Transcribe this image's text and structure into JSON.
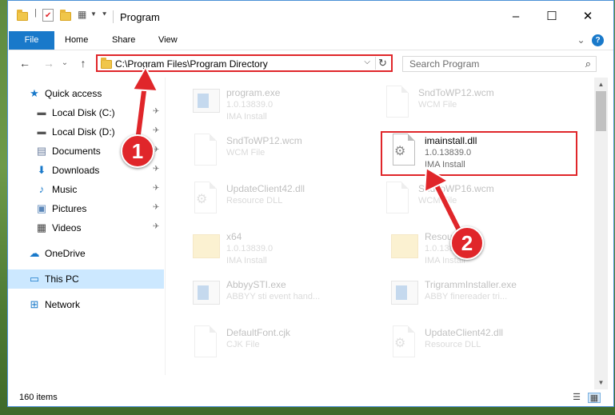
{
  "window": {
    "title": "Program",
    "minimize": "–",
    "maximize": "☐",
    "close": "✕"
  },
  "ribbon": {
    "tabs": [
      "File",
      "Home",
      "Share",
      "View"
    ],
    "expand": "⌄",
    "help": "?"
  },
  "address": {
    "path": "C:\\Program Files\\Program Directory",
    "dropdown": "⌵",
    "refresh": "↻"
  },
  "search": {
    "placeholder": "Search Program",
    "icon": "⌕"
  },
  "nav": {
    "back": "←",
    "forward": "→",
    "recent": "⌄",
    "up": "↑"
  },
  "sidebar": {
    "items": [
      {
        "label": "Quick access",
        "icon": "star-icon",
        "glyph": "★",
        "color": "#1979ca"
      },
      {
        "label": "Local Disk (C:)",
        "icon": "drive-icon",
        "glyph": "▬",
        "color": "#555"
      },
      {
        "label": "Local Disk (D:)",
        "icon": "drive-icon",
        "glyph": "▬",
        "color": "#555"
      },
      {
        "label": "Documents",
        "icon": "documents-icon",
        "glyph": "▤",
        "color": "#6d7fa0"
      },
      {
        "label": "Downloads",
        "icon": "downloads-icon",
        "glyph": "⬇",
        "color": "#1979ca"
      },
      {
        "label": "Music",
        "icon": "music-icon",
        "glyph": "♪",
        "color": "#1979ca"
      },
      {
        "label": "Pictures",
        "icon": "pictures-icon",
        "glyph": "▣",
        "color": "#5a86b8"
      },
      {
        "label": "Videos",
        "icon": "videos-icon",
        "glyph": "▦",
        "color": "#444"
      },
      {
        "label": "OneDrive",
        "icon": "onedrive-icon",
        "glyph": "☁",
        "color": "#1979ca"
      },
      {
        "label": "This PC",
        "icon": "computer-icon",
        "glyph": "▭",
        "color": "#1979ca"
      },
      {
        "label": "Network",
        "icon": "network-icon",
        "glyph": "⊞",
        "color": "#1979ca"
      }
    ],
    "pin": "📌"
  },
  "files": [
    {
      "name": "program.exe",
      "type": "1.0.13839.0",
      "size": "IMA Install",
      "icon": "app-icon"
    },
    {
      "name": "SndToWP12.wcm",
      "type": "WCM File",
      "size": "",
      "icon": "document-icon"
    },
    {
      "name": "SndToWP12.wcm",
      "type": "WCM File",
      "size": "",
      "icon": "document-icon"
    },
    {
      "name": "imainstall.dll",
      "type": "1.0.13839.0",
      "size": "IMA Install",
      "icon": "dll-gear-icon"
    },
    {
      "name": "UpdateClient42.dll",
      "type": "Resource DLL",
      "size": "",
      "icon": "dll-gear-icon"
    },
    {
      "name": "SndToWP16.wcm",
      "type": "WCM File",
      "size": "",
      "icon": "document-icon"
    },
    {
      "name": "x64",
      "type": "1.0.13839.0",
      "size": "IMA Install",
      "icon": "folder-icon"
    },
    {
      "name": "Resources",
      "type": "1.0.13839.0",
      "size": "IMA Install",
      "icon": "folder-icon"
    },
    {
      "name": "AbbyySTI.exe",
      "type": "ABBYY sti event hand...",
      "size": "",
      "icon": "app-icon"
    },
    {
      "name": "TrigrammInstaller.exe",
      "type": "ABBY finereader tri...",
      "size": "",
      "icon": "app-icon"
    },
    {
      "name": "DefaultFont.cjk",
      "type": "CJK File",
      "size": "",
      "icon": "document-icon"
    },
    {
      "name": "UpdateClient42.dll",
      "type": "Resource DLL",
      "size": "",
      "icon": "dll-gear-icon"
    }
  ],
  "status": {
    "count": "160 items",
    "details_view": "☰",
    "tiles_view": "▦"
  },
  "callouts": [
    "1",
    "2"
  ],
  "colors": {
    "accent": "#1979ca",
    "highlight": "#e0262a"
  }
}
